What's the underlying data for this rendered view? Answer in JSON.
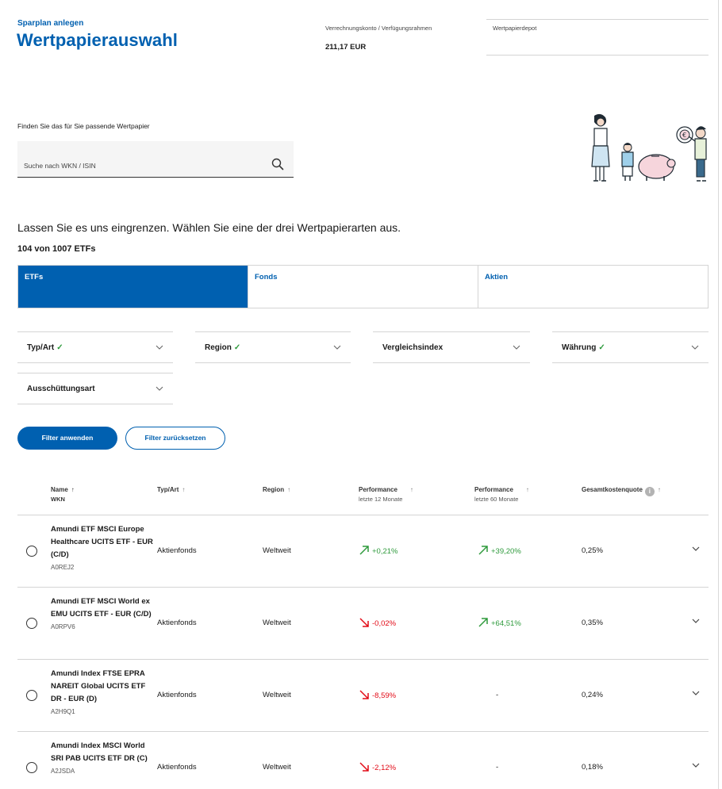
{
  "header": {
    "subtitle": "Sparplan anlegen",
    "title": "Wertpapierauswahl",
    "account_label": "Verrechnungskonto / Verfügungsrahmen",
    "account_value": "211,17 EUR",
    "depot_label": "Wertpapierdepot"
  },
  "search": {
    "intro": "Finden Sie das für Sie passende Wertpapier",
    "placeholder": "Suche nach WKN / ISIN"
  },
  "lead_text": "Lassen Sie es uns eingrenzen. Wählen Sie eine der drei Wertpapierarten aus.",
  "result_count": "104 von 1007 ETFs",
  "tabs": [
    {
      "label": "ETFs",
      "active": true
    },
    {
      "label": "Fonds",
      "active": false
    },
    {
      "label": "Aktien",
      "active": false
    }
  ],
  "filters": [
    {
      "label": "Typ/Art",
      "checked": true
    },
    {
      "label": "Region",
      "checked": true
    },
    {
      "label": "Vergleichsindex",
      "checked": false
    },
    {
      "label": "Währung",
      "checked": true
    },
    {
      "label": "Ausschüttungsart",
      "checked": false
    }
  ],
  "check_glyph": "✓",
  "buttons": {
    "apply": "Filter anwenden",
    "reset": "Filter zurücksetzen"
  },
  "table": {
    "headers": {
      "name": "Name",
      "name_sub": "WKN",
      "type": "Typ/Art",
      "region": "Region",
      "perf12": "Performance",
      "perf12_sub": "letzte 12 Monate",
      "perf60": "Performance",
      "perf60_sub": "letzte 60 Monate",
      "ter": "Gesamtkostenquote",
      "info_glyph": "i",
      "sort_up": "↑"
    },
    "rows": [
      {
        "name": "Amundi ETF MSCI Europe Healthcare UCITS ETF - EUR (C/D)",
        "wkn": "A0REJ2",
        "type": "Aktienfonds",
        "region": "Weltweit",
        "perf12": "+0,21%",
        "perf12_dir": "up",
        "perf60": "+39,20%",
        "perf60_dir": "up",
        "ter": "0,25%"
      },
      {
        "name": "Amundi ETF MSCI World ex EMU UCITS ETF - EUR (C/D)",
        "wkn": "A0RPV6",
        "type": "Aktienfonds",
        "region": "Weltweit",
        "perf12": "-0,02%",
        "perf12_dir": "down",
        "perf60": "+64,51%",
        "perf60_dir": "up",
        "ter": "0,35%"
      },
      {
        "name": "Amundi Index FTSE EPRA NAREIT Global UCITS ETF DR - EUR (D)",
        "wkn": "A2H9Q1",
        "type": "Aktienfonds",
        "region": "Weltweit",
        "perf12": "-8,59%",
        "perf12_dir": "down",
        "perf60": "-",
        "perf60_dir": "none",
        "ter": "0,24%"
      },
      {
        "name": "Amundi Index MSCI World SRI PAB UCITS ETF DR (C)",
        "wkn": "A2JSDA",
        "type": "Aktienfonds",
        "region": "Weltweit",
        "perf12": "-2,12%",
        "perf12_dir": "down",
        "perf60": "-",
        "perf60_dir": "none",
        "ter": "0,18%"
      }
    ]
  },
  "colors": {
    "brand_blue": "#0060b0",
    "positive": "#2e9a3c",
    "negative": "#e20a16"
  }
}
